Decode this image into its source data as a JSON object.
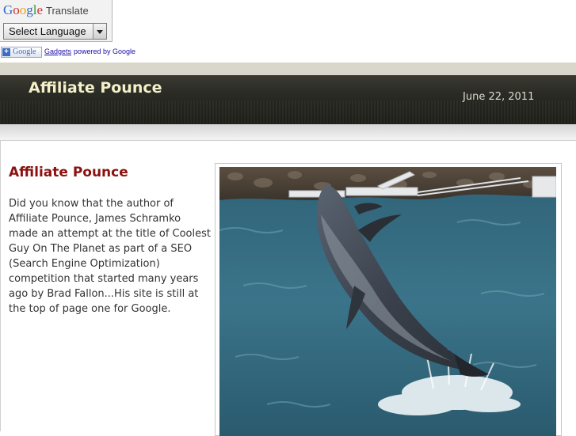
{
  "translate_widget": {
    "logo_text": "Google",
    "translate_label": "Translate",
    "select_value": "Select Language"
  },
  "gadgets_bar": {
    "button_text": "Google",
    "link_text": "Gadgets",
    "powered_text": "powered by Google"
  },
  "header": {
    "site_title": "Affiliate Pounce",
    "date": "June 22, 2011"
  },
  "post": {
    "title": "Affiliate Pounce",
    "body": "Did you know that the author of Affiliate Pounce, James Schramko made an attempt at the title of Coolest Guy On The Planet as part of a SEO (Search Engine Optimization) competition that started many years ago by Brad Fallon...His site is still at the top of page one for Google."
  },
  "colors": {
    "header_bg": "#25251f",
    "site_title": "#f4f0c8",
    "post_title": "#8b1111"
  }
}
